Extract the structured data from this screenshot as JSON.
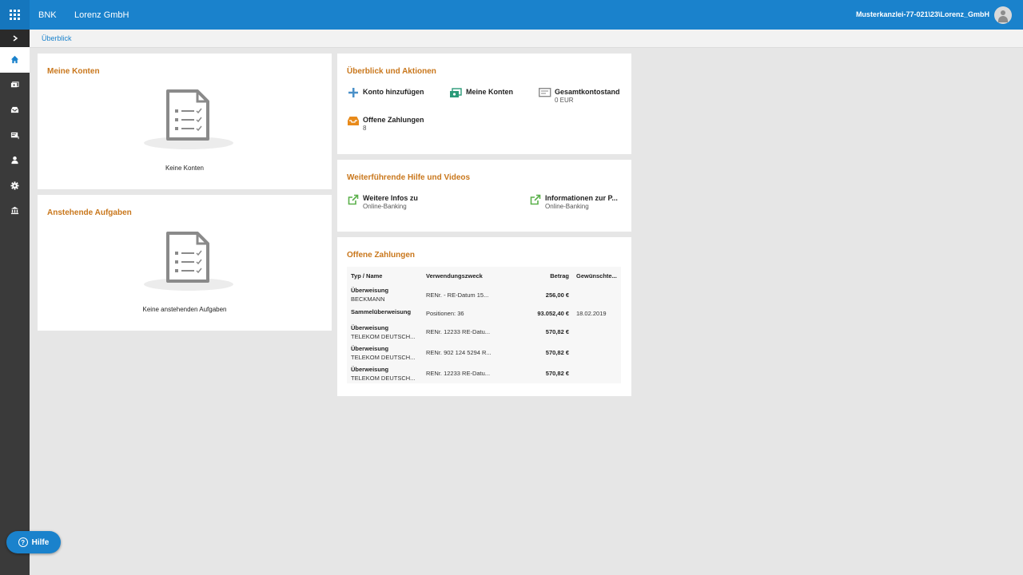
{
  "header": {
    "brand": "BNK",
    "client": "Lorenz GmbH",
    "user": "Musterkanzlei-77-021\\23\\Lorenz_GmbH"
  },
  "breadcrumb": {
    "current": "Überblick"
  },
  "sidebar": {
    "items": [
      {
        "icon": "home-icon"
      },
      {
        "icon": "accounts-icon"
      },
      {
        "icon": "inbox-icon"
      },
      {
        "icon": "payments-icon"
      },
      {
        "icon": "user-icon"
      },
      {
        "icon": "gear-icon"
      },
      {
        "icon": "bank-icon"
      }
    ]
  },
  "meine_konten": {
    "title": "Meine Konten",
    "empty": "Keine Konten"
  },
  "aufgaben": {
    "title": "Anstehende Aufgaben",
    "empty": "Keine anstehenden Aufgaben"
  },
  "aktionen": {
    "title": "Überblick und Aktionen",
    "konto_hinzufuegen": "Konto hinzufügen",
    "meine_konten": "Meine Konten",
    "gesamtkontostand": "Gesamtkontostand",
    "gesamtkontostand_value": "0 EUR",
    "offene_zahlungen": "Offene Zahlungen",
    "offene_zahlungen_count": "8"
  },
  "hilfe": {
    "title": "Weiterführende Hilfe und Videos",
    "link1": "Weitere Infos zu",
    "link1_sub": "Online-Banking",
    "link2": "Informationen zur P...",
    "link2_sub": "Online-Banking"
  },
  "zahlungen": {
    "title": "Offene Zahlungen",
    "headers": {
      "typ": "Typ / Name",
      "zweck": "Verwendungszweck",
      "betrag": "Betrag",
      "datum": "Gewünschte..."
    },
    "rows": [
      {
        "typ": "Überweisung",
        "name": "BECKMANN",
        "zweck": "RENr. - RE-Datum 15...",
        "betrag": "256,00 €",
        "datum": ""
      },
      {
        "typ": "Sammelüberweisung",
        "name": "",
        "zweck": "Positionen: 36",
        "betrag": "93.052,40 €",
        "datum": "18.02.2019"
      },
      {
        "typ": "Überweisung",
        "name": "TELEKOM DEUTSCH...",
        "zweck": "RENr. 12233 RE-Datu...",
        "betrag": "570,82 €",
        "datum": ""
      },
      {
        "typ": "Überweisung",
        "name": "TELEKOM DEUTSCH...",
        "zweck": "RENr. 902 124 5294 R...",
        "betrag": "570,82 €",
        "datum": ""
      },
      {
        "typ": "Überweisung",
        "name": "TELEKOM DEUTSCH...",
        "zweck": "RENr. 12233 RE-Datu...",
        "betrag": "570,82 €",
        "datum": ""
      }
    ]
  },
  "help_button": {
    "label": "Hilfe"
  },
  "colors": {
    "primary": "#1a82cc",
    "accent_title": "#c9771c",
    "sidebar": "#3a3a3a"
  }
}
